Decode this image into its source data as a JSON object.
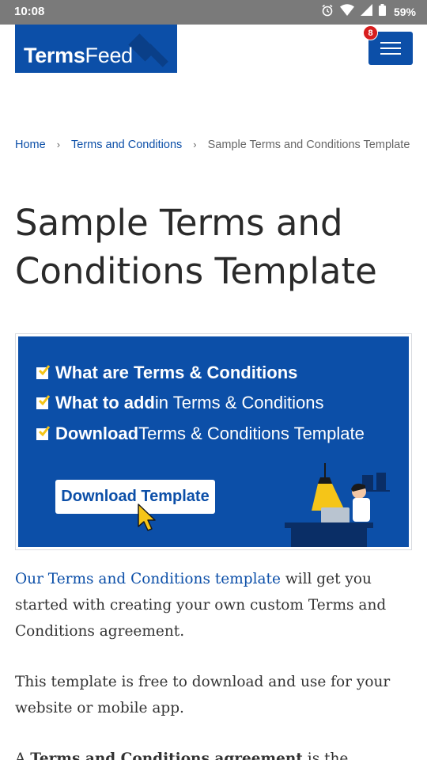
{
  "status_bar": {
    "time": "10:08",
    "battery": "59%",
    "icons": [
      "alarm-icon",
      "wifi-icon",
      "signal-icon",
      "battery-icon"
    ]
  },
  "header": {
    "logo": {
      "bold": "Terms",
      "thin": "Feed"
    },
    "menu_badge": "8",
    "menu_icon": "hamburger-icon"
  },
  "breadcrumb": {
    "home": "Home",
    "separator": "›",
    "terms": "Terms and Conditions",
    "current": "Sample Terms and Conditions Template"
  },
  "title": "Sample Terms and Conditions Template",
  "banner": {
    "items": [
      {
        "bold": "What are Terms & Conditions",
        "rest": ""
      },
      {
        "bold": "What to add",
        "rest": " in Terms & Conditions"
      },
      {
        "bold": "Download",
        "rest": " Terms & Conditions Template"
      }
    ],
    "button": "Download Template"
  },
  "content": {
    "p1_link": "Our Terms and Conditions template",
    "p1_rest": " will get you started with creating your own custom Terms and Conditions agreement.",
    "p2": "This template is free to download and use for your website or mobile app.",
    "p3_start": "A ",
    "p3_bold": "Terms and Conditions agreement",
    "p3_rest": " is the"
  },
  "colors": {
    "brand_blue": "#0c4fa8",
    "badge_red": "#d81e1e",
    "check_yellow": "#f5c518"
  }
}
